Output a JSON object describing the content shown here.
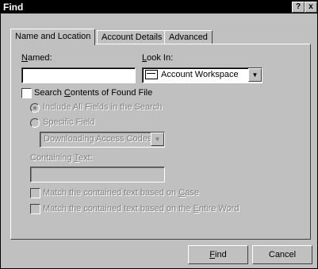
{
  "window": {
    "title": "Find"
  },
  "title_buttons": {
    "help": "?",
    "close": "x"
  },
  "tabs": [
    {
      "label": "Name and Location",
      "active": true
    },
    {
      "label": "Account Details"
    },
    {
      "label": "Advanced"
    }
  ],
  "named": {
    "label_u": "N",
    "label_rest": "amed:",
    "value": ""
  },
  "look_in": {
    "label_u": "L",
    "label_rest": "ook In:",
    "value": "Account Workspace"
  },
  "search_contents": {
    "pre": "Search ",
    "u": "C",
    "post": "ontents of Found File",
    "checked": false
  },
  "radio_include_all": {
    "label": "Include All Fields in the Search",
    "selected": true
  },
  "radio_specific": {
    "label": "Specific Field",
    "selected": false
  },
  "field_select": {
    "value": "Downloading Access Codes"
  },
  "containing": {
    "pre": "Containing ",
    "u": "T",
    "post": "ext:",
    "value": ""
  },
  "match_case": {
    "pre": "Match the contained text based on ",
    "u": "C",
    "post": "ase"
  },
  "match_word": {
    "pre": "Match the contained text based on the ",
    "u": "E",
    "post": "ntire Word"
  },
  "buttons": {
    "find_u": "F",
    "find_rest": "ind",
    "cancel": "Cancel"
  },
  "colors": {
    "face": "#c0c0c0",
    "disabled_text": "#808080",
    "title_bg": "#000000"
  }
}
